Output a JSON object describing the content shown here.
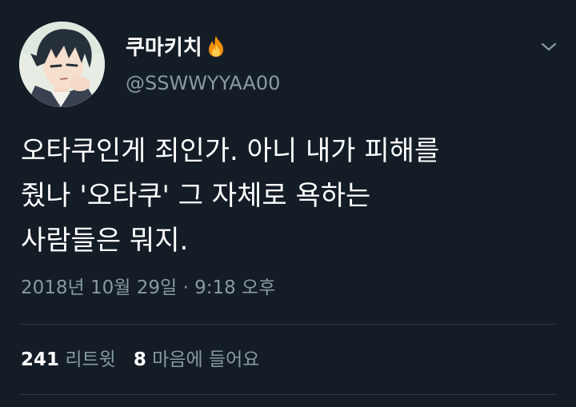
{
  "tweet": {
    "display_name": "쿠마키치",
    "handle": "@SSWWYYAA00",
    "name_emoji_icon": "fire-icon",
    "menu_icon": "chevron-down-icon",
    "text_lines": [
      "오타쿠인게 죄인가. 아니 내가 피해를",
      "줬나 '오타쿠' 그 자체로 욕하는",
      "사람들은 뭐지."
    ],
    "timestamp": "2018년 10월 29일 · 9:18 오후",
    "retweets": {
      "count": "241",
      "label": "리트윗"
    },
    "likes": {
      "count": "8",
      "label": "마음에 들어요"
    }
  },
  "colors": {
    "background": "#141d26",
    "primary_text": "#ffffff",
    "secondary_text": "#8899a6",
    "divider": "#2b3a48"
  }
}
